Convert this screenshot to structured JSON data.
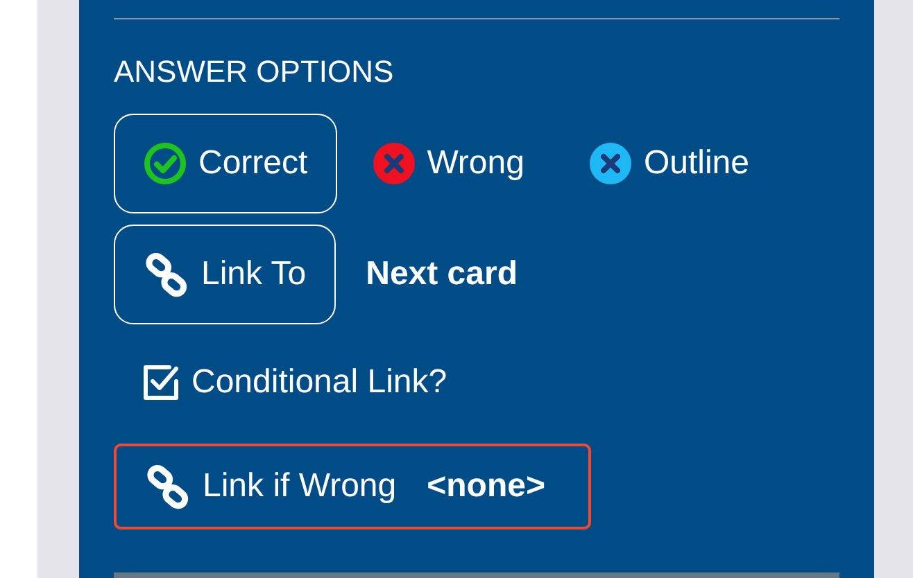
{
  "section_title": "ANSWER OPTIONS",
  "answer_options": [
    {
      "kind": "correct",
      "label": "Correct",
      "selected": true
    },
    {
      "kind": "wrong",
      "label": "Wrong",
      "selected": false
    },
    {
      "kind": "outline",
      "label": "Outline",
      "selected": false
    }
  ],
  "link_to": {
    "label": "Link To",
    "value": "Next card"
  },
  "conditional_link": {
    "label": "Conditional Link?",
    "checked": true
  },
  "link_if_wrong": {
    "label": "Link if Wrong",
    "value": "<none>"
  }
}
